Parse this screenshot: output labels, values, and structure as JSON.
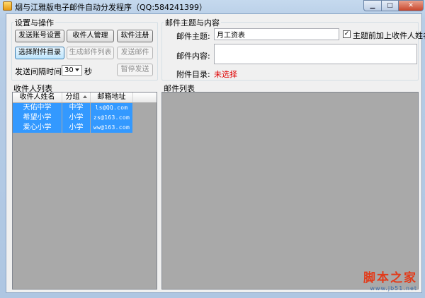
{
  "window": {
    "title": "烟与江雅版电子邮件自动分发程序（QQ:584241399）",
    "min_icon": "minimize-icon",
    "max_icon": "maximize-icon",
    "close_icon": "close-icon",
    "min_glyph": "▁",
    "max_glyph": "□",
    "close_glyph": "✕"
  },
  "settings": {
    "group_title": "设置与操作",
    "account_btn": "发送账号设置",
    "recipient_mgr_btn": "收件人管理",
    "register_btn": "软件注册",
    "select_attach_btn": "选择附件目录",
    "gen_list_btn": "生成邮件列表",
    "send_btn": "发送邮件",
    "interval_label": "发送间隔时间:",
    "interval_value": "30",
    "interval_unit": "秒",
    "pause_btn": "暂停发送"
  },
  "mail": {
    "group_title": "邮件主题与内容",
    "subject_label": "邮件主题:",
    "subject_value": "月工资表",
    "prefix_checkbox_label": "主题前加上收件人姓名",
    "prefix_checked": true,
    "check_glyph": "✓",
    "content_label": "邮件内容:",
    "content_value": "",
    "attach_label": "附件目录:",
    "attach_value": "未选择",
    "attach_color": "#e00000"
  },
  "recipients": {
    "group_title": "收件人列表",
    "columns": [
      "收件人姓名",
      "分组",
      "邮箱地址"
    ],
    "rows": [
      {
        "name": "天佑中学",
        "group": "中学",
        "email": "ls@QQ.com"
      },
      {
        "name": "希望小学",
        "group": "小学",
        "email": "zs@163.com"
      },
      {
        "name": "爱心小学",
        "group": "小学",
        "email": "ww@163.com"
      }
    ],
    "selection_color": "#3399ff"
  },
  "maillist": {
    "group_title": "邮件列表"
  },
  "watermark": {
    "main": "脚本之家",
    "sub": "www.jb51.net"
  }
}
